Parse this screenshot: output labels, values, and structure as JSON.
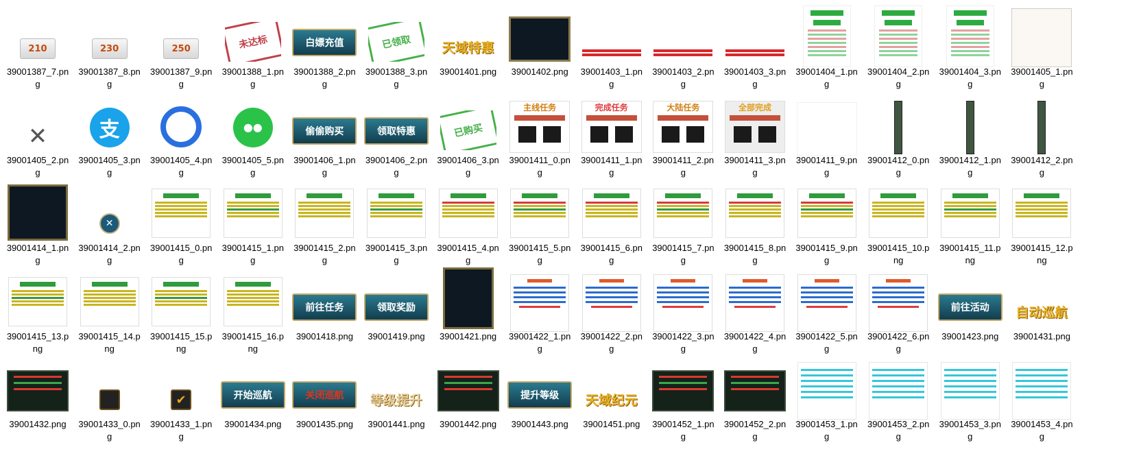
{
  "window": {
    "title": ""
  },
  "files": [
    {
      "name": "39001387_7.png",
      "caption_lines": [
        "39001387_7.pn",
        "g"
      ],
      "thumb_text": "210"
    },
    {
      "name": "39001387_8.png",
      "caption_lines": [
        "39001387_8.pn",
        "g"
      ],
      "thumb_text": "230"
    },
    {
      "name": "39001387_9.png",
      "caption_lines": [
        "39001387_9.pn",
        "g"
      ],
      "thumb_text": "250"
    },
    {
      "name": "39001388_1.png",
      "caption_lines": [
        "39001388_1.pn",
        "g"
      ],
      "thumb_text": "未达标"
    },
    {
      "name": "39001388_2.png",
      "caption_lines": [
        "39001388_2.pn",
        "g"
      ],
      "thumb_text": "白嫖充值"
    },
    {
      "name": "39001388_3.png",
      "caption_lines": [
        "39001388_3.pn",
        "g"
      ],
      "thumb_text": "已领取"
    },
    {
      "name": "39001401.png",
      "caption_lines": [
        "39001401.png"
      ],
      "thumb_text": "天域特惠"
    },
    {
      "name": "39001402.png",
      "caption_lines": [
        "39001402.png"
      ],
      "thumb_text": ""
    },
    {
      "name": "39001403_1.png",
      "caption_lines": [
        "39001403_1.pn",
        "g"
      ],
      "thumb_text": ""
    },
    {
      "name": "39001403_2.png",
      "caption_lines": [
        "39001403_2.pn",
        "g"
      ],
      "thumb_text": ""
    },
    {
      "name": "39001403_3.png",
      "caption_lines": [
        "39001403_3.pn",
        "g"
      ],
      "thumb_text": ""
    },
    {
      "name": "39001404_1.png",
      "caption_lines": [
        "39001404_1.pn",
        "g"
      ],
      "thumb_text": ""
    },
    {
      "name": "39001404_2.png",
      "caption_lines": [
        "39001404_2.pn",
        "g"
      ],
      "thumb_text": ""
    },
    {
      "name": "39001404_3.png",
      "caption_lines": [
        "39001404_3.pn",
        "g"
      ],
      "thumb_text": ""
    },
    {
      "name": "39001405_1.png",
      "caption_lines": [
        "39001405_1.pn",
        "g"
      ],
      "thumb_text": ""
    },
    {
      "name": "39001405_2.png",
      "caption_lines": [
        "39001405_2.pn",
        "g"
      ],
      "thumb_text": "✕"
    },
    {
      "name": "39001405_3.png",
      "caption_lines": [
        "39001405_3.pn",
        "g"
      ],
      "thumb_text": "支"
    },
    {
      "name": "39001405_4.png",
      "caption_lines": [
        "39001405_4.pn",
        "g"
      ],
      "thumb_text": ""
    },
    {
      "name": "39001405_5.png",
      "caption_lines": [
        "39001405_5.pn",
        "g"
      ],
      "thumb_text": ""
    },
    {
      "name": "39001406_1.png",
      "caption_lines": [
        "39001406_1.pn",
        "g"
      ],
      "thumb_text": "偷偷购买"
    },
    {
      "name": "39001406_2.png",
      "caption_lines": [
        "39001406_2.pn",
        "g"
      ],
      "thumb_text": "领取特惠"
    },
    {
      "name": "39001406_3.png",
      "caption_lines": [
        "39001406_3.pn",
        "g"
      ],
      "thumb_text": "已购买"
    },
    {
      "name": "39001411_0.png",
      "caption_lines": [
        "39001411_0.pn",
        "g"
      ],
      "thumb_text": "主线任务"
    },
    {
      "name": "39001411_1.png",
      "caption_lines": [
        "39001411_1.pn",
        "g"
      ],
      "thumb_text": "完成任务"
    },
    {
      "name": "39001411_2.png",
      "caption_lines": [
        "39001411_2.pn",
        "g"
      ],
      "thumb_text": "大陆任务"
    },
    {
      "name": "39001411_3.png",
      "caption_lines": [
        "39001411_3.pn",
        "g"
      ],
      "thumb_text": "全部完成"
    },
    {
      "name": "39001411_9.png",
      "caption_lines": [
        "39001411_9.pn",
        "g"
      ],
      "thumb_text": ""
    },
    {
      "name": "39001412_0.png",
      "caption_lines": [
        "39001412_0.pn",
        "g"
      ],
      "thumb_text": ""
    },
    {
      "name": "39001412_1.png",
      "caption_lines": [
        "39001412_1.pn",
        "g"
      ],
      "thumb_text": ""
    },
    {
      "name": "39001412_2.png",
      "caption_lines": [
        "39001412_2.pn",
        "g"
      ],
      "thumb_text": ""
    },
    {
      "name": "39001414_1.png",
      "caption_lines": [
        "39001414_1.pn",
        "g"
      ],
      "thumb_text": ""
    },
    {
      "name": "39001414_2.png",
      "caption_lines": [
        "39001414_2.pn",
        "g"
      ],
      "thumb_text": "✕"
    },
    {
      "name": "39001415_0.png",
      "caption_lines": [
        "39001415_0.pn",
        "g"
      ],
      "thumb_text": ""
    },
    {
      "name": "39001415_1.png",
      "caption_lines": [
        "39001415_1.pn",
        "g"
      ],
      "thumb_text": ""
    },
    {
      "name": "39001415_2.png",
      "caption_lines": [
        "39001415_2.pn",
        "g"
      ],
      "thumb_text": ""
    },
    {
      "name": "39001415_3.png",
      "caption_lines": [
        "39001415_3.pn",
        "g"
      ],
      "thumb_text": ""
    },
    {
      "name": "39001415_4.png",
      "caption_lines": [
        "39001415_4.pn",
        "g"
      ],
      "thumb_text": ""
    },
    {
      "name": "39001415_5.png",
      "caption_lines": [
        "39001415_5.pn",
        "g"
      ],
      "thumb_text": ""
    },
    {
      "name": "39001415_6.png",
      "caption_lines": [
        "39001415_6.pn",
        "g"
      ],
      "thumb_text": ""
    },
    {
      "name": "39001415_7.png",
      "caption_lines": [
        "39001415_7.pn",
        "g"
      ],
      "thumb_text": ""
    },
    {
      "name": "39001415_8.png",
      "caption_lines": [
        "39001415_8.pn",
        "g"
      ],
      "thumb_text": ""
    },
    {
      "name": "39001415_9.png",
      "caption_lines": [
        "39001415_9.pn",
        "g"
      ],
      "thumb_text": ""
    },
    {
      "name": "39001415_10.png",
      "caption_lines": [
        "39001415_10.p",
        "ng"
      ],
      "thumb_text": ""
    },
    {
      "name": "39001415_11.png",
      "caption_lines": [
        "39001415_11.p",
        "ng"
      ],
      "thumb_text": ""
    },
    {
      "name": "39001415_12.png",
      "caption_lines": [
        "39001415_12.p",
        "ng"
      ],
      "thumb_text": ""
    },
    {
      "name": "39001415_13.png",
      "caption_lines": [
        "39001415_13.p",
        "ng"
      ],
      "thumb_text": ""
    },
    {
      "name": "39001415_14.png",
      "caption_lines": [
        "39001415_14.p",
        "ng"
      ],
      "thumb_text": ""
    },
    {
      "name": "39001415_15.png",
      "caption_lines": [
        "39001415_15.p",
        "ng"
      ],
      "thumb_text": ""
    },
    {
      "name": "39001415_16.png",
      "caption_lines": [
        "39001415_16.p",
        "ng"
      ],
      "thumb_text": ""
    },
    {
      "name": "39001418.png",
      "caption_lines": [
        "39001418.png"
      ],
      "thumb_text": "前往任务"
    },
    {
      "name": "39001419.png",
      "caption_lines": [
        "39001419.png"
      ],
      "thumb_text": "领取奖励"
    },
    {
      "name": "39001421.png",
      "caption_lines": [
        "39001421.png"
      ],
      "thumb_text": ""
    },
    {
      "name": "39001422_1.png",
      "caption_lines": [
        "39001422_1.pn",
        "g"
      ],
      "thumb_text": ""
    },
    {
      "name": "39001422_2.png",
      "caption_lines": [
        "39001422_2.pn",
        "g"
      ],
      "thumb_text": ""
    },
    {
      "name": "39001422_3.png",
      "caption_lines": [
        "39001422_3.pn",
        "g"
      ],
      "thumb_text": ""
    },
    {
      "name": "39001422_4.png",
      "caption_lines": [
        "39001422_4.pn",
        "g"
      ],
      "thumb_text": ""
    },
    {
      "name": "39001422_5.png",
      "caption_lines": [
        "39001422_5.pn",
        "g"
      ],
      "thumb_text": ""
    },
    {
      "name": "39001422_6.png",
      "caption_lines": [
        "39001422_6.pn",
        "g"
      ],
      "thumb_text": ""
    },
    {
      "name": "39001423.png",
      "caption_lines": [
        "39001423.png"
      ],
      "thumb_text": "前往活动"
    },
    {
      "name": "39001431.png",
      "caption_lines": [
        "39001431.png"
      ],
      "thumb_text": "自动巡航"
    },
    {
      "name": "39001432.png",
      "caption_lines": [
        "39001432.png"
      ],
      "thumb_text": ""
    },
    {
      "name": "39001433_0.png",
      "caption_lines": [
        "39001433_0.pn",
        "g"
      ],
      "thumb_text": ""
    },
    {
      "name": "39001433_1.png",
      "caption_lines": [
        "39001433_1.pn",
        "g"
      ],
      "thumb_text": "✔"
    },
    {
      "name": "39001434.png",
      "caption_lines": [
        "39001434.png"
      ],
      "thumb_text": "开始巡航"
    },
    {
      "name": "39001435.png",
      "caption_lines": [
        "39001435.png"
      ],
      "thumb_text": "关闭巡航"
    },
    {
      "name": "39001441.png",
      "caption_lines": [
        "39001441.png"
      ],
      "thumb_text": "等级提升"
    },
    {
      "name": "39001442.png",
      "caption_lines": [
        "39001442.png"
      ],
      "thumb_text": ""
    },
    {
      "name": "39001443.png",
      "caption_lines": [
        "39001443.png"
      ],
      "thumb_text": "提升等级"
    },
    {
      "name": "39001451.png",
      "caption_lines": [
        "39001451.png"
      ],
      "thumb_text": "天域纪元"
    },
    {
      "name": "39001452_1.png",
      "caption_lines": [
        "39001452_1.pn",
        "g"
      ],
      "thumb_text": ""
    },
    {
      "name": "39001452_2.png",
      "caption_lines": [
        "39001452_2.pn",
        "g"
      ],
      "thumb_text": ""
    },
    {
      "name": "39001453_1.png",
      "caption_lines": [
        "39001453_1.pn",
        "g"
      ],
      "thumb_text": ""
    },
    {
      "name": "39001453_2.png",
      "caption_lines": [
        "39001453_2.pn",
        "g"
      ],
      "thumb_text": ""
    },
    {
      "name": "39001453_3.png",
      "caption_lines": [
        "39001453_3.pn",
        "g"
      ],
      "thumb_text": ""
    },
    {
      "name": "39001453_4.png",
      "caption_lines": [
        "39001453_4.pn",
        "g"
      ],
      "thumb_text": ""
    }
  ]
}
